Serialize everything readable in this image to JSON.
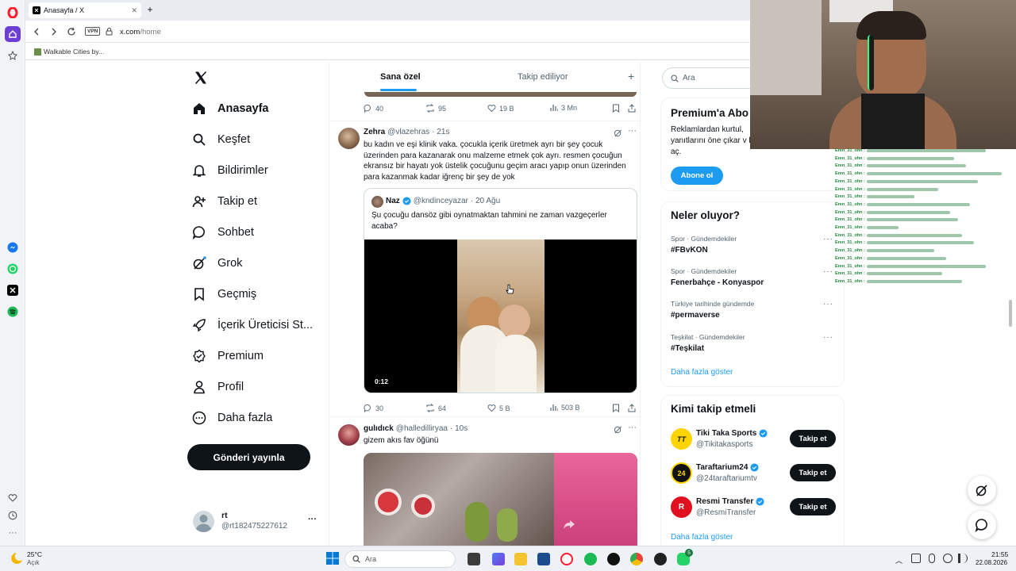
{
  "browser": {
    "tab_title": "Anasayfa / X",
    "new_tab": "+",
    "vpn": "VPN",
    "url_domain": "x.com",
    "url_path": "/home",
    "bookmark": "Walkable Cities by..."
  },
  "nav": {
    "items": [
      {
        "label": "Anasayfa",
        "icon": "home-icon"
      },
      {
        "label": "Keşfet",
        "icon": "search-icon"
      },
      {
        "label": "Bildirimler",
        "icon": "bell-icon"
      },
      {
        "label": "Takip et",
        "icon": "add-user-icon"
      },
      {
        "label": "Sohbet",
        "icon": "chat-icon"
      },
      {
        "label": "Grok",
        "icon": "grok-icon"
      },
      {
        "label": "Geçmiş",
        "icon": "bookmark-icon"
      },
      {
        "label": "İçerik Üreticisi St...",
        "icon": "rocket-icon"
      },
      {
        "label": "Premium",
        "icon": "verified-icon"
      },
      {
        "label": "Profil",
        "icon": "person-icon"
      },
      {
        "label": "Daha fazla",
        "icon": "more-circle-icon"
      }
    ],
    "post_button": "Gönderi yayınla",
    "account": {
      "name": "rt",
      "handle": "@rt182475227612",
      "more": "···"
    }
  },
  "feed": {
    "tabs": [
      "Sana özel",
      "Takip ediliyor"
    ],
    "add_tab": "+",
    "top_actions": {
      "replies": "40",
      "reposts": "95",
      "likes": "19 B",
      "views": "3 Mn"
    },
    "tweet1": {
      "name": "Zehra",
      "handle": "@vlazehras",
      "time": "· 21s",
      "text": "bu kadın ve eşi klinik vaka. çocukla içerik üretmek ayrı bir şey çocuk üzerinden para kazanarak onu malzeme etmek çok ayrı. resmen çocuğun ekransız bir hayatı yok üstelik çocuğunu geçim aracı yapıp onun  üzerinden para kazanmak kadar iğrenç bir şey de yok",
      "quote": {
        "name": "Naz",
        "handle": "@kndinceyazar",
        "time": "· 20 Ağu",
        "text": "Şu çocuğu dansöz gibi oynatmaktan tahmini ne zaman vazgeçerler acaba?",
        "video_time": "0:12"
      },
      "actions": {
        "replies": "30",
        "reposts": "64",
        "likes": "5 B",
        "views": "503 B"
      }
    },
    "tweet2": {
      "name": "gulıdıck",
      "handle": "@halledilliryaa",
      "time": "· 10s",
      "text": "gizem akıs fav öğünü"
    }
  },
  "right": {
    "search_placeholder": "Ara",
    "premium": {
      "title": "Premium'a Abo",
      "text": "Reklamlardan kurtul, yanıtlarını öne çıkar v kilidini aç.",
      "button": "Abone ol"
    },
    "trends": {
      "title": "Neler oluyor?",
      "items": [
        {
          "category": "Spor · Gündemdekiler",
          "name": "#FBvKON"
        },
        {
          "category": "Spor · Gündemdekiler",
          "name": "Fenerbahçe - Konyaspor"
        },
        {
          "category": "Türkiye tarihinde gündemde",
          "name": "#permaverse"
        },
        {
          "category": "Teşkilat · Gündemdekiler",
          "name": "#Teşkilat"
        }
      ],
      "more": "Daha fazla göster"
    },
    "who_to_follow": {
      "title": "Kimi takip etmeli",
      "items": [
        {
          "name": "Tiki Taka Sports",
          "handle": "@Tikitakasports",
          "button": "Takip et"
        },
        {
          "name": "Taraftarium24",
          "handle": "@24taraftariumtv",
          "button": "Takip et"
        },
        {
          "name": "Resmi Transfer",
          "handle": "@ResmiTransfer",
          "button": "Takip et"
        }
      ],
      "more": "Daha fazla göster"
    }
  },
  "chat": {
    "user": "Eren_31_ohn :"
  },
  "taskbar": {
    "weather_temp": "25°C",
    "weather_desc": "Açık",
    "search": "Ara",
    "time": "21:55",
    "date": "22.08.2026",
    "whatsapp_badge": "5"
  },
  "colors": {
    "accent": "#1d9bf0",
    "text": "#0f1419",
    "secondary": "#536471",
    "opera_red": "#ff1b2d"
  }
}
